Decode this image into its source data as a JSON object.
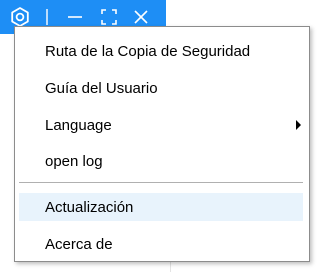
{
  "titlebar": {
    "background": "#1e8ef5",
    "icons": [
      "settings-icon",
      "separator",
      "minimize-icon",
      "maximize-icon",
      "close-icon"
    ]
  },
  "menu": {
    "items": [
      {
        "label": "Ruta de la Copia de Seguridad"
      },
      {
        "label": "Guía del Usuario"
      },
      {
        "label": "Language",
        "submenu": true
      },
      {
        "label": "open log"
      },
      {
        "label": "Actualización",
        "highlighted": true
      },
      {
        "label": "Acerca de"
      }
    ],
    "highlight_color": "#e8f3fc"
  }
}
